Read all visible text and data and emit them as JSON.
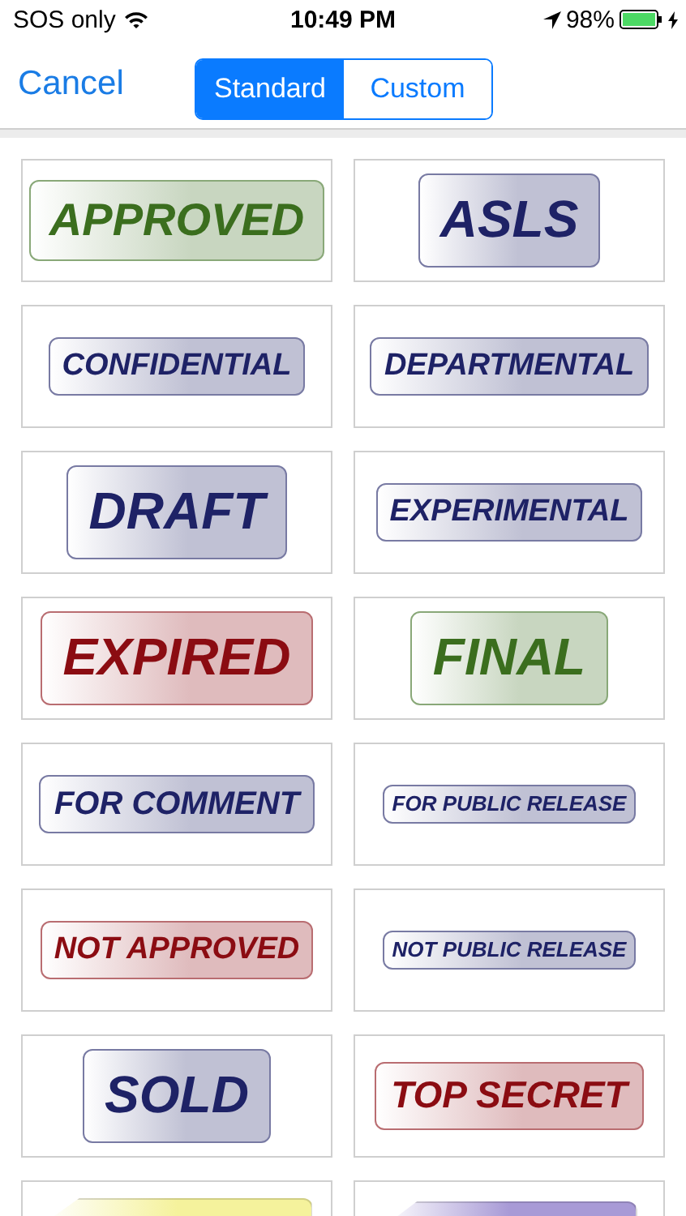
{
  "status_bar": {
    "carrier": "SOS only",
    "time": "10:49 PM",
    "battery": "98%"
  },
  "nav": {
    "cancel": "Cancel",
    "segments": [
      {
        "label": "Standard",
        "selected": true
      },
      {
        "label": "Custom",
        "selected": false
      }
    ]
  },
  "stamps": [
    {
      "kind": "stamp",
      "label": "APPROVED",
      "color": "#3b6e1e"
    },
    {
      "kind": "stamp",
      "label": "ASLS",
      "color": "#1e2266"
    },
    {
      "kind": "stamp",
      "label": "CONFIDENTIAL",
      "color": "#1e2266"
    },
    {
      "kind": "stamp",
      "label": "DEPARTMENTAL",
      "color": "#1e2266"
    },
    {
      "kind": "stamp",
      "label": "DRAFT",
      "color": "#1e2266"
    },
    {
      "kind": "stamp",
      "label": "EXPERIMENTAL",
      "color": "#1e2266"
    },
    {
      "kind": "stamp",
      "label": "EXPIRED",
      "color": "#8b0c12"
    },
    {
      "kind": "stamp",
      "label": "FINAL",
      "color": "#3b6e1e"
    },
    {
      "kind": "stamp",
      "label": "FOR COMMENT",
      "color": "#1e2266"
    },
    {
      "kind": "stamp",
      "label": "FOR PUBLIC RELEASE",
      "color": "#1e2266"
    },
    {
      "kind": "stamp",
      "label": "NOT APPROVED",
      "color": "#8b0c12"
    },
    {
      "kind": "stamp",
      "label": "NOT PUBLIC RELEASE",
      "color": "#1e2266"
    },
    {
      "kind": "stamp",
      "label": "SOLD",
      "color": "#1e2266"
    },
    {
      "kind": "stamp",
      "label": "TOP SECRET",
      "color": "#8b0c12"
    },
    {
      "kind": "tag",
      "color": "#f5f29c"
    },
    {
      "kind": "tag",
      "color": "#a89ad6"
    }
  ]
}
